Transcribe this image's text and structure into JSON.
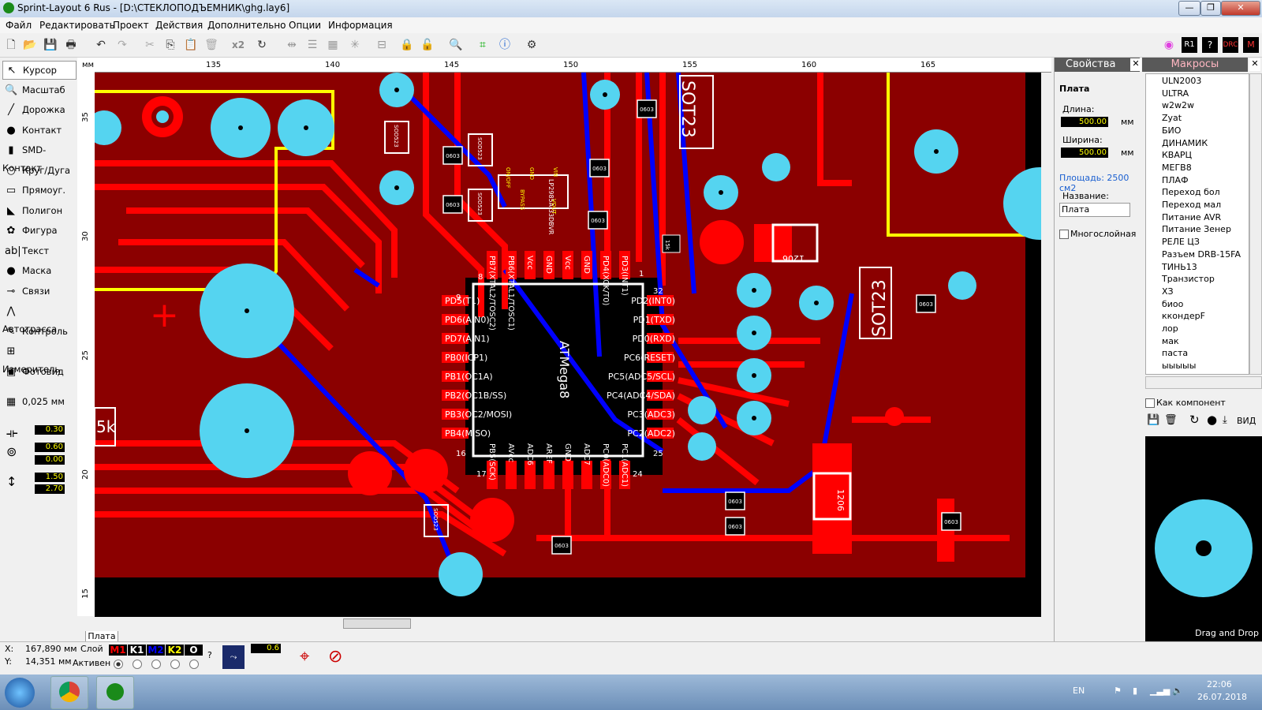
{
  "window": {
    "title": "Sprint-Layout 6 Rus - [D:\\СТЕКЛОПОДЪЕМНИК\\ghg.lay6]",
    "minimize": "—",
    "restore": "❐",
    "close": "✕"
  },
  "menu": [
    "Файл",
    "Редактировать",
    "Проект",
    "Действия",
    "Дополнительно",
    "Опции",
    "Информация"
  ],
  "toolbar": {
    "x2_label": "x2"
  },
  "tools": [
    {
      "label": "Курсор",
      "icon": "cursor-icon",
      "glyph": "↖"
    },
    {
      "label": "Масштаб",
      "icon": "zoom-icon",
      "glyph": "🔍"
    },
    {
      "label": "Дорожка",
      "icon": "track-icon",
      "glyph": "╱"
    },
    {
      "label": "Контакт",
      "icon": "pad-icon",
      "glyph": "●"
    },
    {
      "label": "SMD-Контакт",
      "icon": "smd-pad-icon",
      "glyph": "▮"
    },
    {
      "label": "Круг/Дуга",
      "icon": "circle-icon",
      "glyph": "○"
    },
    {
      "label": "Прямоуг.",
      "icon": "rectangle-icon",
      "glyph": "▭"
    },
    {
      "label": "Полигон",
      "icon": "polygon-icon",
      "glyph": "◣"
    },
    {
      "label": "Фигура",
      "icon": "figure-icon",
      "glyph": "✿"
    },
    {
      "label": "Текст",
      "icon": "text-icon",
      "glyph": "ab|"
    },
    {
      "label": "Маска",
      "icon": "mask-icon",
      "glyph": "●"
    },
    {
      "label": "Связи",
      "icon": "connections-icon",
      "glyph": "⊸"
    },
    {
      "label": "Автотрасса",
      "icon": "autoroute-icon",
      "glyph": "⋀"
    },
    {
      "label": "Контроль",
      "icon": "control-icon",
      "glyph": "✎"
    },
    {
      "label": "Измеритель",
      "icon": "measure-icon",
      "glyph": "⊞"
    },
    {
      "label": "Фотовид",
      "icon": "photo-view-icon",
      "glyph": "▣"
    }
  ],
  "grid": {
    "value": "0,025 мм"
  },
  "params": {
    "track_width": "0.30",
    "pad_outer": "0.60",
    "pad_inner": "0.00",
    "smd_w": "1.50",
    "smd_h": "2.70"
  },
  "ruler": {
    "unit": "мм",
    "h": [
      "135",
      "140",
      "145",
      "150",
      "155",
      "160",
      "165"
    ],
    "v": [
      "35",
      "30",
      "25",
      "20",
      "15"
    ]
  },
  "board": {
    "labels": [
      "SOT23",
      "SOT23",
      "ATMega8",
      "LP2985A-33DBVR",
      "1206",
      "1206",
      "SOD523",
      "SOD523",
      "SOD523",
      "SOD523",
      "0603",
      "0603",
      "0603",
      "0603",
      "0603",
      "0603",
      "0603",
      "0603",
      "0603",
      "0603",
      "5k",
      "15k"
    ],
    "ic_pins_left": [
      "PD5(T1)",
      "PD6(AIN0)",
      "PD7(AIN1)",
      "PB0(ICP1)",
      "PB1(OC1A)",
      "PB2(OC1B/SS)",
      "PB3(OC2/MOSI)",
      "PB4(MISO)"
    ],
    "ic_pins_right": [
      "PD2(INT0)",
      "PD1(TXD)",
      "PD0(RXD)",
      "PC6(RESET)",
      "PC5(ADC5/SCL)",
      "PC4(ADC4/SDA)",
      "PC3(ADC3)",
      "PC2(ADC2)"
    ],
    "ic_pins_top": [
      "PB7(XTAL2/TOSC2)",
      "PB6(XTAL1/TOSC1)",
      "Vcc",
      "GND",
      "Vcc",
      "GND",
      "PD4(XCK/T0)",
      "PD3(INT1)"
    ],
    "ic_pins_bottom": [
      "PB5(SCK)",
      "AVcc",
      "ADC6",
      "AREF",
      "GND",
      "ADC7",
      "PC0(ADC0)",
      "PC1(ADC1)"
    ],
    "pin_numbers": [
      "1",
      "8",
      "9",
      "16",
      "17",
      "24",
      "25",
      "32"
    ],
    "regulator_pins": [
      "ON/OFF",
      "GND",
      "VIN",
      "BYPASS",
      "VOUT"
    ],
    "colors": {
      "background": "#000000",
      "copper_fill": "#8b0000",
      "copper_top": "#ff0000",
      "copper_bottom": "#0000ff",
      "pad": "#55d4f0",
      "outline": "#ffff00",
      "silk": "#ffffff"
    }
  },
  "properties": {
    "title": "Свойства",
    "section": "Плата",
    "length_label": "Длина:",
    "length_value": "500.00",
    "width_label": "Ширина:",
    "width_value": "500.00",
    "unit": "мм",
    "area": "Площадь: 2500 см2",
    "name_label": "Название:",
    "name_value": "Плата",
    "multilayer": "Многослойная"
  },
  "macros": {
    "title": "Макросы",
    "items": [
      "ULN2003",
      "ULTRA",
      "w2w2w",
      "Zyat",
      "БИО",
      "ДИНАМИК",
      "КВАРЦ",
      "МЕГВ8",
      "ПЛАФ",
      "Переход бол",
      "Переход мал",
      "Питание AVR",
      "Питание Зенер",
      "РЕЛЕ ЦЗ",
      "Разъем DRB-15FA",
      "ТИНЬ13",
      "Транзистор",
      "ХЗ",
      "биоо",
      "ккондерF",
      "лор",
      "мак",
      "паста",
      "ыыыыы"
    ],
    "as_component": "Как компонент",
    "view": "ВИД",
    "drag_drop": "Drag and Drop"
  },
  "tab": "Плата",
  "status": {
    "x_label": "X:",
    "x_value": "167,890 мм",
    "y_label": "Y:",
    "y_value": "14,351 мм",
    "layer_label": "Слой",
    "active_label": "Активен",
    "layers": [
      {
        "name": "M1",
        "color": "#ff0000",
        "bg": "#000"
      },
      {
        "name": "K1",
        "color": "#ffffff",
        "bg": "#000"
      },
      {
        "name": "M2",
        "color": "#0000ff",
        "bg": "#000"
      },
      {
        "name": "K2",
        "color": "#ffff00",
        "bg": "#000"
      },
      {
        "name": "O",
        "color": "#ffffff",
        "bg": "#000"
      }
    ],
    "zoom_value": "0.6",
    "help": "?"
  },
  "taskbar": {
    "lang": "EN",
    "time": "22:06",
    "date": "26.07.2018"
  }
}
